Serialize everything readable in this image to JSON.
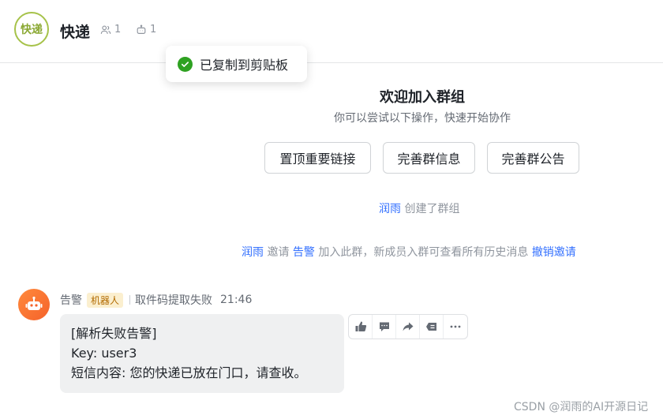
{
  "header": {
    "avatar_text": "快递",
    "title": "快递",
    "member_count": "1",
    "bot_count": "1",
    "icons": {
      "members": "members-icon",
      "bots": "robot-icon"
    }
  },
  "toast": {
    "text": "已复制到剪贴板",
    "icon": "check-circle-icon",
    "color": "#2ea121"
  },
  "welcome": {
    "title": "欢迎加入群组",
    "subtitle": "你可以尝试以下操作，快速开始协作",
    "buttons": [
      "置顶重要链接",
      "完善群信息",
      "完善群公告"
    ]
  },
  "system_messages": {
    "created": {
      "user": "润雨",
      "text": "创建了群组"
    },
    "invited": {
      "inviter": "润雨",
      "verb": "邀请",
      "invitee": "告警",
      "text": "加入此群，新成员入群可查看所有历史消息",
      "action": "撤销邀请"
    }
  },
  "message": {
    "sender": "告警",
    "badge": "机器人",
    "status": "取件码提取失败",
    "time": "21:46",
    "lines": [
      "[解析失败告警]",
      "Key: user3",
      "短信内容: 您的快递已放在门口，请查收。"
    ]
  },
  "message_actions": [
    "thumbs-up-icon",
    "reply-icon",
    "forward-icon",
    "quote-icon",
    "more-icon"
  ],
  "watermark": "CSDN @润雨的AI开源日记",
  "colors": {
    "link": "#3370ff",
    "accent_avatar": "#a6c249",
    "bot_avatar": "#f5622a"
  }
}
